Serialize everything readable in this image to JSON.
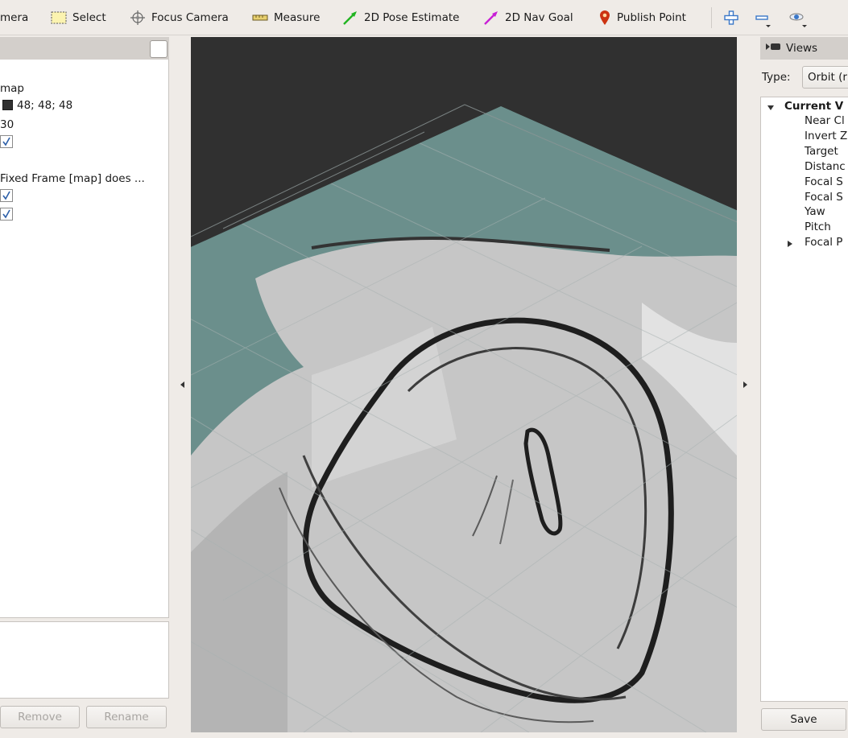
{
  "toolbar": {
    "tools": [
      {
        "label": "mera",
        "icon": "camera-icon"
      },
      {
        "label": "Select",
        "icon": "select-icon"
      },
      {
        "label": "Focus Camera",
        "icon": "focus-camera-icon"
      },
      {
        "label": "Measure",
        "icon": "measure-icon"
      },
      {
        "label": "2D Pose Estimate",
        "icon": "pose-estimate-arrow-icon"
      },
      {
        "label": "2D Nav Goal",
        "icon": "nav-goal-arrow-icon"
      },
      {
        "label": "Publish Point",
        "icon": "publish-point-pin-icon"
      }
    ],
    "icons": [
      "add-tool-icon",
      "remove-tool-icon",
      "visibility-eye-icon"
    ],
    "colors": {
      "pose_estimate": "#21b421",
      "nav_goal": "#c81fd6",
      "publish_point": "#cc3311",
      "add_remove": "#3a77c8"
    }
  },
  "displays": {
    "fixed_frame": "map",
    "background_color": "48; 48; 48",
    "frame_rate": "30",
    "global_status": "Fixed Frame [map] does ...",
    "checked": [
      true,
      true,
      true
    ]
  },
  "display_buttons": {
    "remove_label": "Remove",
    "rename_label": "Rename"
  },
  "views": {
    "title": "Views",
    "type_label": "Type:",
    "type_value": "Orbit (r",
    "tree": {
      "current_view": "Current V",
      "properties": [
        "Near Cl",
        "Invert Z",
        "Target",
        "Distanc",
        "Focal S",
        "Focal S",
        "Yaw",
        "Pitch",
        "Focal P"
      ]
    },
    "save_label": "Save"
  },
  "viewport": {
    "background": "#303030",
    "grid_color": "#9ea8a8",
    "unknown_area_color": "#6b8f8c"
  }
}
